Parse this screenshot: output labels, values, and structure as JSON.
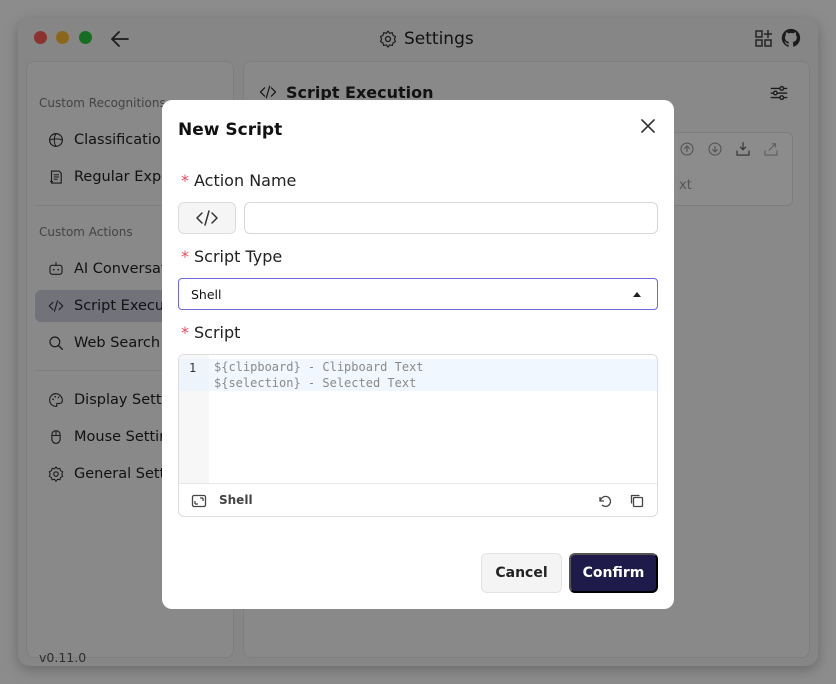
{
  "window": {
    "title": "Settings"
  },
  "sidebar": {
    "sections": [
      {
        "title": "Custom Recognitions"
      },
      {
        "title": "Custom Actions"
      }
    ],
    "items": [
      {
        "label": "Classification",
        "icon": "globe-icon"
      },
      {
        "label": "Regular Expre",
        "icon": "document-icon"
      },
      {
        "label": "AI Conversati",
        "icon": "robot-icon"
      },
      {
        "label": "Script Executi",
        "icon": "code-icon",
        "active": true
      },
      {
        "label": "Web Search",
        "icon": "search-icon"
      },
      {
        "label": "Display Settin",
        "icon": "palette-icon"
      },
      {
        "label": "Mouse Settin",
        "icon": "mouse-icon"
      },
      {
        "label": "General Setti",
        "icon": "gear-icon"
      }
    ],
    "version": "v0.11.0"
  },
  "main": {
    "title": "Script Execution",
    "card_text": "xt"
  },
  "modal": {
    "title": "New Script",
    "action_name": {
      "label": "Action Name",
      "value": "",
      "placeholder": ""
    },
    "script_type": {
      "label": "Script Type",
      "value": "Shell"
    },
    "script": {
      "label": "Script",
      "line_number": "1",
      "lines": [
        "${clipboard} - Clipboard Text",
        "${selection} - Selected Text"
      ],
      "language": "Shell"
    },
    "cancel_label": "Cancel",
    "confirm_label": "Confirm"
  },
  "colors": {
    "accent": "#1e1b4b",
    "required": "#e54b5d",
    "select_border": "#6b6bd8"
  }
}
